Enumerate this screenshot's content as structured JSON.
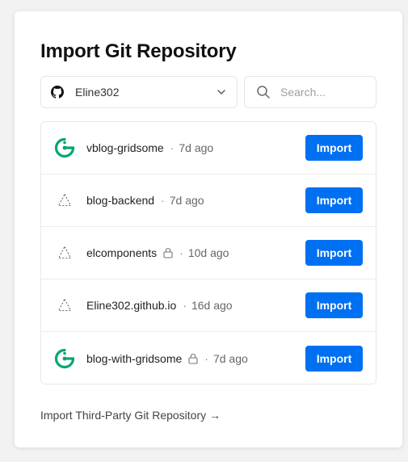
{
  "page": {
    "title": "Import Git Repository"
  },
  "account": {
    "name": "Eline302",
    "icon": "github-icon"
  },
  "search": {
    "placeholder": "Search...",
    "value": ""
  },
  "repos": [
    {
      "name": "vblog-gridsome",
      "age": "7d ago",
      "icon": "gridsome-icon",
      "locked": false,
      "import_label": "Import"
    },
    {
      "name": "blog-backend",
      "age": "7d ago",
      "icon": "triangle-icon",
      "locked": false,
      "import_label": "Import"
    },
    {
      "name": "elcomponents",
      "age": "10d ago",
      "icon": "triangle-icon",
      "locked": true,
      "import_label": "Import"
    },
    {
      "name": "Eline302.github.io",
      "age": "16d ago",
      "icon": "triangle-icon",
      "locked": false,
      "import_label": "Import"
    },
    {
      "name": "blog-with-gridsome",
      "age": "7d ago",
      "icon": "gridsome-icon",
      "locked": true,
      "import_label": "Import"
    }
  ],
  "separator": "·",
  "third_party_link": "Import Third-Party Git Repository →",
  "colors": {
    "accent": "#0070f3",
    "gridsome": "#00a672"
  }
}
